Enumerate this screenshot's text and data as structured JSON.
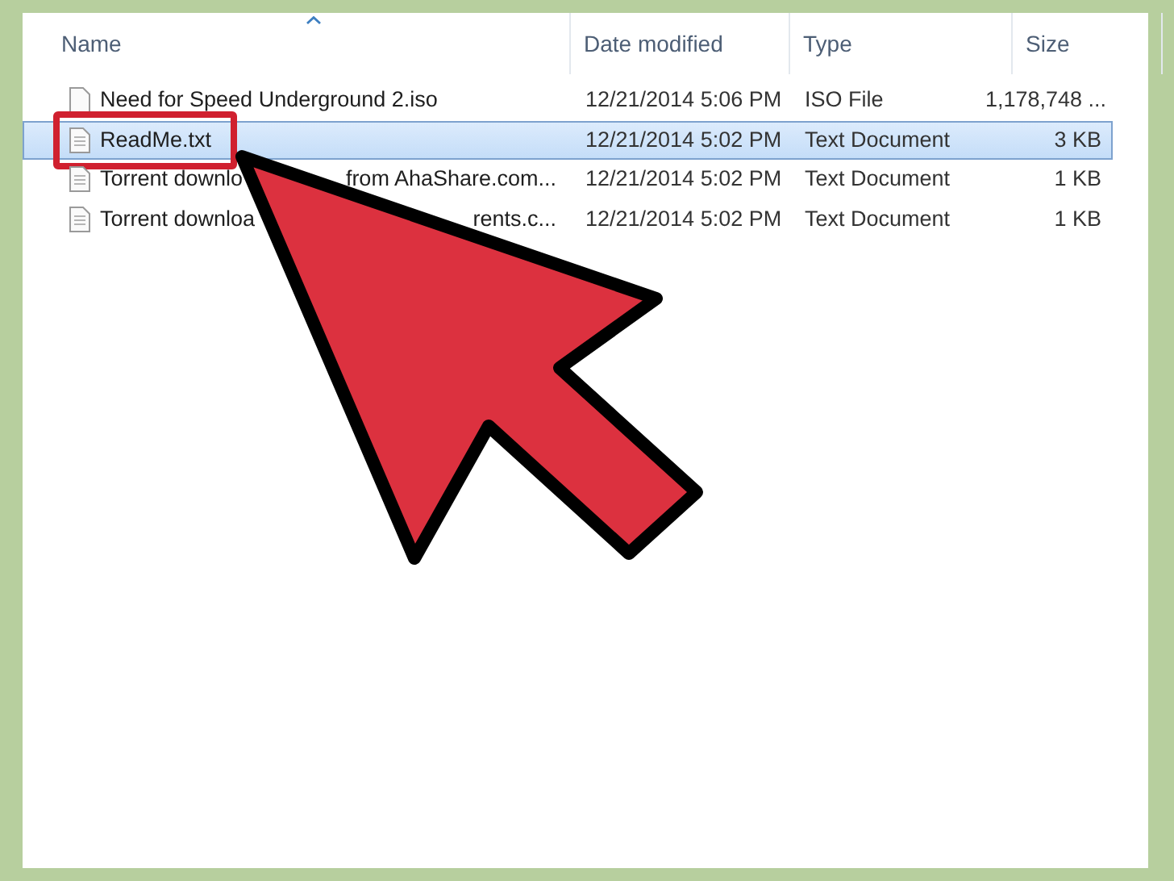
{
  "columns": [
    {
      "label": "Name",
      "sorted": true
    },
    {
      "label": "Date modified",
      "sorted": false
    },
    {
      "label": "Type",
      "sorted": false
    },
    {
      "label": "Size",
      "sorted": false
    }
  ],
  "rows": [
    {
      "name": "Need for Speed Underground 2.iso",
      "date": "12/21/2014 5:06 PM",
      "type": "ISO File",
      "size": "1,178,748 ...",
      "selected": false,
      "highlighted": false
    },
    {
      "name": "ReadMe.txt",
      "date": "12/21/2014 5:02 PM",
      "type": "Text Document",
      "size": "3 KB",
      "selected": true,
      "highlighted": true
    },
    {
      "name": "Torrent downlo",
      "name_tail": "from AhaShare.com...",
      "date": "12/21/2014 5:02 PM",
      "type": "Text Document",
      "size": "1 KB",
      "selected": false,
      "highlighted": false
    },
    {
      "name": "Torrent downloa",
      "name_tail": "rents.c...",
      "date": "12/21/2014 5:02 PM",
      "type": "Text Document",
      "size": "1 KB",
      "selected": false,
      "highlighted": false
    }
  ]
}
